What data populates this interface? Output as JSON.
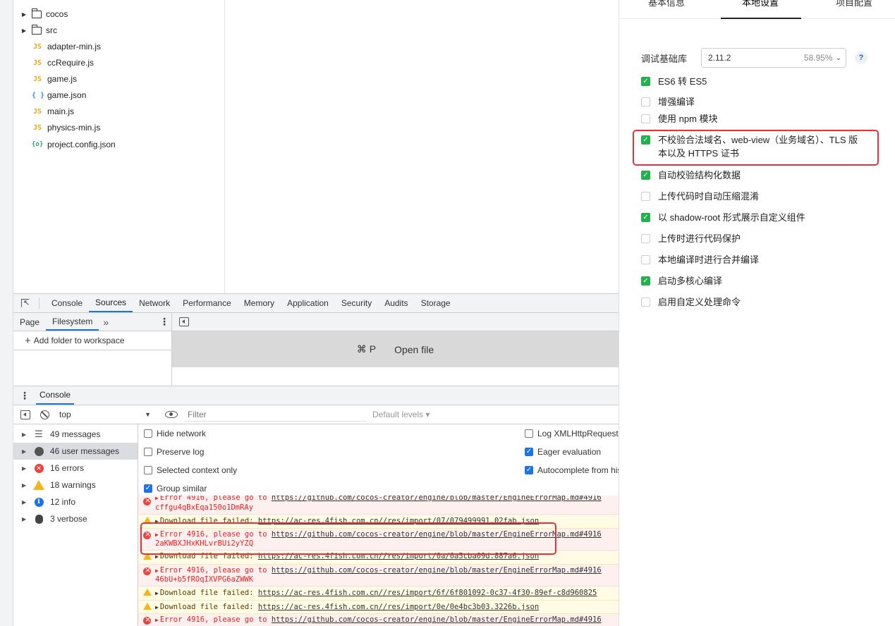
{
  "file_tree": {
    "folders": [
      "cocos",
      "src"
    ],
    "files": [
      {
        "name": "adapter-min.js",
        "type": "js",
        "icon": "JS"
      },
      {
        "name": "ccRequire.js",
        "type": "js",
        "icon": "JS"
      },
      {
        "name": "game.js",
        "type": "js",
        "icon": "JS"
      },
      {
        "name": "game.json",
        "type": "json",
        "icon": "{ }"
      },
      {
        "name": "main.js",
        "type": "js",
        "icon": "JS"
      },
      {
        "name": "physics-min.js",
        "type": "js",
        "icon": "JS"
      },
      {
        "name": "project.config.json",
        "type": "config",
        "icon": "{o}"
      }
    ]
  },
  "devtools": {
    "tabs": [
      "Console",
      "Sources",
      "Network",
      "Performance",
      "Memory",
      "Application",
      "Security",
      "Audits",
      "Storage"
    ],
    "active_tab": "Sources",
    "sources": {
      "tabs": [
        "Page",
        "Filesystem"
      ],
      "active": "Filesystem",
      "more": "»",
      "add_folder": "Add folder to workspace",
      "open_file_shortcut": "⌘ P",
      "open_file_label": "Open file"
    },
    "drawer": {
      "tab": "Console"
    },
    "console": {
      "context": "top",
      "filter_placeholder": "Filter",
      "levels": "Default levels ▾",
      "sidebar": [
        {
          "label": "49 messages",
          "icon": "list-icon"
        },
        {
          "label": "46 user messages",
          "icon": "user-icon"
        },
        {
          "label": "16 errors",
          "icon": "error-icon"
        },
        {
          "label": "18 warnings",
          "icon": "warning-icon"
        },
        {
          "label": "12 info",
          "icon": "info-icon"
        },
        {
          "label": "3 verbose",
          "icon": "bug-icon"
        }
      ],
      "settings_left": [
        {
          "label": "Hide network",
          "checked": false
        },
        {
          "label": "Preserve log",
          "checked": false
        },
        {
          "label": "Selected context only",
          "checked": false
        },
        {
          "label": "Group similar",
          "checked": true
        }
      ],
      "settings_right": [
        {
          "label": "Log XMLHttpRequests",
          "checked": false
        },
        {
          "label": "Eager evaluation",
          "checked": true
        },
        {
          "label": "Autocomplete from history",
          "checked": true
        }
      ],
      "messages": [
        {
          "level": "error",
          "text": "Error 4916, please go to ",
          "url": "https://github.com/cocos-creator/engine/blob/master/EngineErrorMap.md#4916",
          "line2": "cffgu4qBxEqa150o1DmRAy"
        },
        {
          "level": "warn",
          "text": "Download file failed: ",
          "url": "https://ac-res.4fish.com.cn//res/import/07/079499991.02fab.json",
          "line2": ""
        },
        {
          "level": "error",
          "text": "Error 4916, please go to ",
          "url": "https://github.com/cocos-creator/engine/blob/master/EngineErrorMap.md#4916",
          "line2": "2aKWBXJHxKHLvrBUi2yYZQ"
        },
        {
          "level": "warn",
          "text": "Download file failed: ",
          "url": "https://ac-res.4fish.com.cn//res/import/0a/0a5cba09d.887a6.json",
          "line2": ""
        },
        {
          "level": "error",
          "text": "Error 4916, please go to ",
          "url": "https://github.com/cocos-creator/engine/blob/master/EngineErrorMap.md#4916",
          "line2": "46bU+b5fROqIXVPG6aZWWK"
        },
        {
          "level": "warn",
          "text": "Download file failed: ",
          "url": "https://ac-res.4fish.com.cn//res/import/6f/6f801092-0c37-4f30-89ef-c8d960825",
          "line2": ""
        },
        {
          "level": "warn",
          "text": "Download file failed: ",
          "url": "https://ac-res.4fish.com.cn//res/import/0e/0e4bc3b03.3226b.json",
          "line2": ""
        },
        {
          "level": "error",
          "text": "Error 4916, please go to ",
          "url": "https://github.com/cocos-creator/engine/blob/master/EngineErrorMap.md#4916",
          "line2": ""
        }
      ]
    }
  },
  "settings_panel": {
    "tabs": [
      "基本信息",
      "本地设置",
      "项目配置"
    ],
    "active_tab": "本地设置",
    "library_label": "调试基础库",
    "library_version": "2.11.2",
    "library_percent": "58.95%",
    "help": "?",
    "options": [
      {
        "label": "ES6 转 ES5",
        "checked": true
      },
      {
        "label": "增强编译",
        "checked": false
      },
      {
        "label": "使用 npm 模块",
        "checked": false
      },
      {
        "label": "不校验合法域名、web-view（业务域名）、TLS 版本以及 HTTPS 证书",
        "checked": true
      },
      {
        "label": "自动校验结构化数据",
        "checked": true
      },
      {
        "label": "上传代码时自动压缩混淆",
        "checked": false
      },
      {
        "label": "以 shadow-root 形式展示自定义组件",
        "checked": true
      },
      {
        "label": "上传时进行代码保护",
        "checked": false
      },
      {
        "label": "本地编译时进行合并编译",
        "checked": false
      },
      {
        "label": "启动多核心编译",
        "checked": true
      },
      {
        "label": "启用自定义处理命令",
        "checked": false
      }
    ]
  },
  "colors": {
    "accent": "#1a73e8",
    "checkbox_green": "#22b14c",
    "error_red": "#e8211f",
    "highlight_box": "#e8323a"
  }
}
